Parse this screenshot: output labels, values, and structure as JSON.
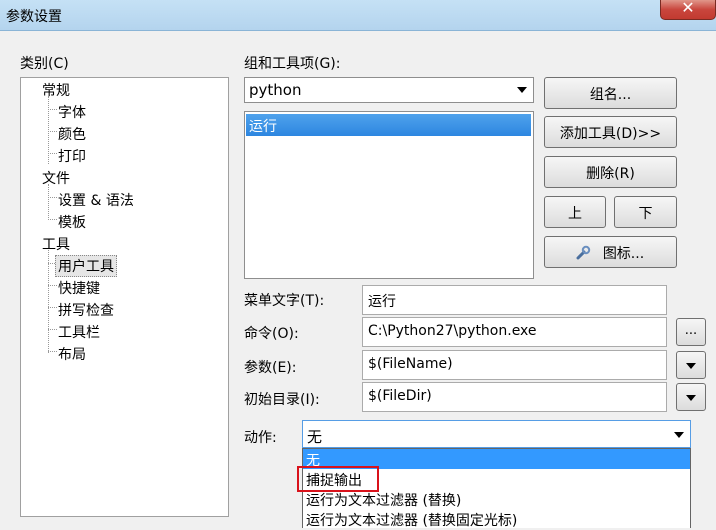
{
  "window": {
    "title": "参数设置",
    "close_glyph": "✕"
  },
  "categories_label": "类别(C)",
  "tree": [
    "常规",
    "字体",
    "颜色",
    "打印",
    "文件",
    "设置 & 语法",
    "模板",
    "工具",
    "用户工具",
    "快捷键",
    "拼写检查",
    "工具栏",
    "布局"
  ],
  "group_label": "组和工具项(G):",
  "group_combo_value": "python",
  "tool_list": [
    "运行"
  ],
  "buttons": {
    "group_name": "组名...",
    "add_tool": "添加工具(D)>>",
    "delete": "删除(R)",
    "up": "上",
    "down": "下",
    "icon": "图标..."
  },
  "fields": {
    "menu_text_label": "菜单文字(T):",
    "menu_text_value": "运行",
    "command_label": "命令(O):",
    "command_value": "C:\\Python27\\python.exe",
    "browse": "...",
    "params_label": "参数(E):",
    "params_value": "$(FileName)",
    "init_dir_label": "初始目录(I):",
    "init_dir_value": "$(FileDir)"
  },
  "action": {
    "label": "动作:",
    "value": "无",
    "options": [
      "无",
      "捕捉输出",
      "运行为文本过滤器 (替换)",
      "运行为文本过滤器 (替换固定光标)"
    ]
  },
  "colors": {
    "selection": "#3399ff",
    "highlight_box": "#d9121b",
    "titlebar": "#b9d7f0"
  }
}
